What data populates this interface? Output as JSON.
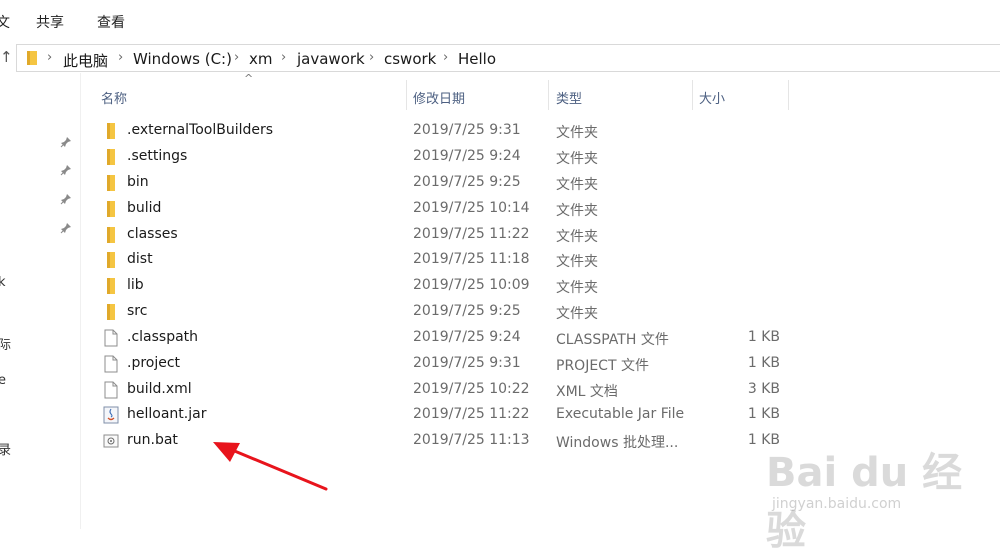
{
  "ribbon": {
    "cut_tab": "文",
    "share_tab": "共享",
    "view_tab": "查看"
  },
  "address": {
    "crumbs": [
      "此电脑",
      "Windows (C:)",
      "xm",
      "javawork",
      "cswork",
      "Hello"
    ]
  },
  "nav": {
    "fragments": [
      "k",
      "际",
      "e",
      "录"
    ]
  },
  "columns": {
    "name": "名称",
    "date": "修改日期",
    "type": "类型",
    "size": "大小"
  },
  "files": [
    {
      "name": ".externalToolBuilders",
      "date": "2019/7/25 9:31",
      "type": "文件夹",
      "size": "",
      "icon": "folder-icon"
    },
    {
      "name": ".settings",
      "date": "2019/7/25 9:24",
      "type": "文件夹",
      "size": "",
      "icon": "folder-icon"
    },
    {
      "name": "bin",
      "date": "2019/7/25 9:25",
      "type": "文件夹",
      "size": "",
      "icon": "folder-icon"
    },
    {
      "name": "bulid",
      "date": "2019/7/25 10:14",
      "type": "文件夹",
      "size": "",
      "icon": "folder-icon"
    },
    {
      "name": "classes",
      "date": "2019/7/25 11:22",
      "type": "文件夹",
      "size": "",
      "icon": "folder-icon"
    },
    {
      "name": "dist",
      "date": "2019/7/25 11:18",
      "type": "文件夹",
      "size": "",
      "icon": "folder-icon"
    },
    {
      "name": "lib",
      "date": "2019/7/25 10:09",
      "type": "文件夹",
      "size": "",
      "icon": "folder-icon"
    },
    {
      "name": "src",
      "date": "2019/7/25 9:25",
      "type": "文件夹",
      "size": "",
      "icon": "folder-icon"
    },
    {
      "name": ".classpath",
      "date": "2019/7/25 9:24",
      "type": "CLASSPATH 文件",
      "size": "1 KB",
      "icon": "file-icon"
    },
    {
      "name": ".project",
      "date": "2019/7/25 9:31",
      "type": "PROJECT 文件",
      "size": "1 KB",
      "icon": "file-icon"
    },
    {
      "name": "build.xml",
      "date": "2019/7/25 10:22",
      "type": "XML 文档",
      "size": "3 KB",
      "icon": "file-icon"
    },
    {
      "name": "helloant.jar",
      "date": "2019/7/25 11:22",
      "type": "Executable Jar File",
      "size": "1 KB",
      "icon": "jar-icon"
    },
    {
      "name": "run.bat",
      "date": "2019/7/25 11:13",
      "type": "Windows 批处理...",
      "size": "1 KB",
      "icon": "bat-icon"
    }
  ],
  "watermark": {
    "logo": "Bai du 经验",
    "url": "jingyan.baidu.com"
  },
  "colors": {
    "folder": "#f5c542",
    "arrow": "#e8141c",
    "header_text": "#4d6082"
  }
}
